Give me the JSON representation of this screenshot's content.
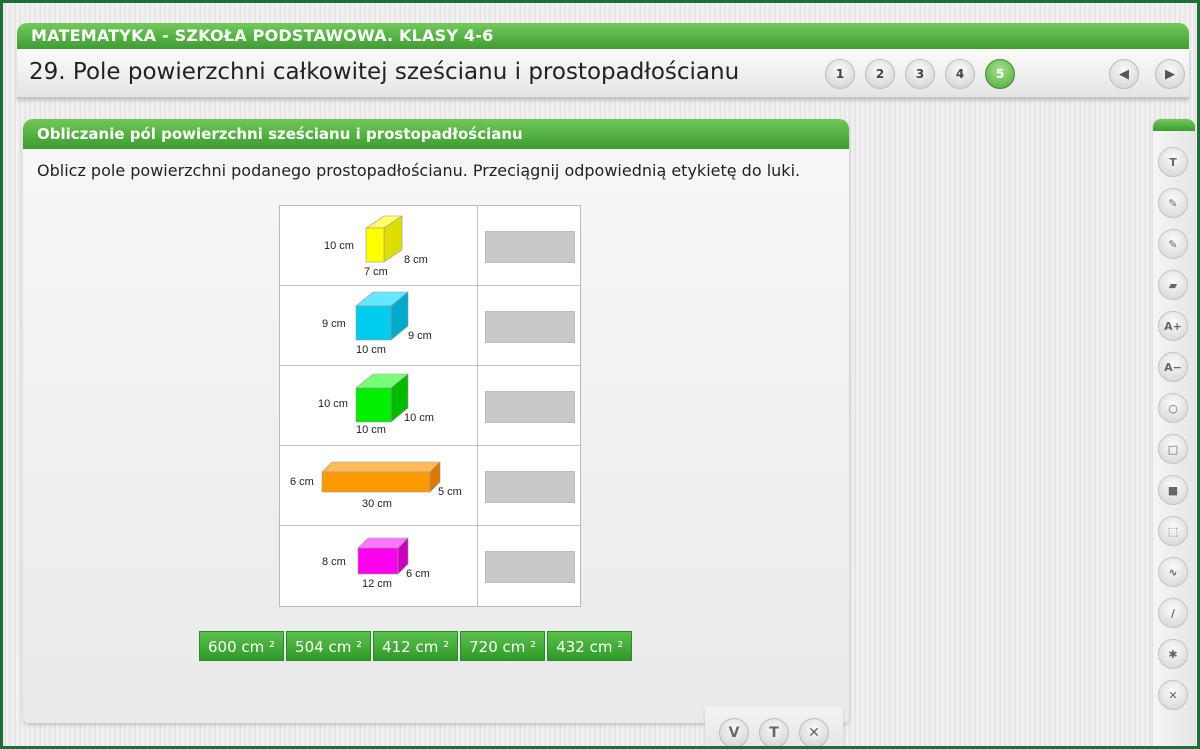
{
  "header": {
    "course": "MATEMATYKA - SZKOŁA PODSTAWOWA. KLASY 4-6",
    "lesson_title": "29. Pole powierzchni całkowitej sześcianu i prostopadłościanu",
    "pages": [
      "1",
      "2",
      "3",
      "4",
      "5"
    ],
    "active_page": "5",
    "prev_glyph": "◀",
    "next_glyph": "▶"
  },
  "panel": {
    "title": "Obliczanie pól powierzchni sześcianu i prostopadłościanu",
    "instruction": "Oblicz pole powierzchni podanego prostopadłościanu. Przeciągnij odpowiednią etykietę do luki."
  },
  "solids": [
    {
      "color": "#ffff00",
      "height_label": "10 cm",
      "depth_label": "8 cm",
      "width_label": "7 cm"
    },
    {
      "color": "#00ccee",
      "height_label": "9 cm",
      "depth_label": "9 cm",
      "width_label": "10 cm"
    },
    {
      "color": "#00ee00",
      "height_label": "10 cm",
      "depth_label": "10 cm",
      "width_label": "10 cm"
    },
    {
      "color": "#ff9900",
      "height_label": "6 cm",
      "depth_label": "5 cm",
      "width_label": "30 cm"
    },
    {
      "color": "#ff00ee",
      "height_label": "8 cm",
      "depth_label": "6 cm",
      "width_label": "12 cm"
    }
  ],
  "answers": [
    "600 cm ²",
    "504 cm ²",
    "412 cm ²",
    "720 cm ²",
    "432 cm ²"
  ],
  "panel_tools": [
    {
      "name": "check",
      "glyph": "V"
    },
    {
      "name": "hint",
      "glyph": "T"
    },
    {
      "name": "reset",
      "glyph": "✕"
    }
  ],
  "sidebar_tools": [
    {
      "name": "text",
      "glyph": "T"
    },
    {
      "name": "pen",
      "glyph": "✎"
    },
    {
      "name": "marker",
      "glyph": "✎"
    },
    {
      "name": "eraser",
      "glyph": "▰"
    },
    {
      "name": "font-larger",
      "glyph": "A+"
    },
    {
      "name": "font-smaller",
      "glyph": "A−"
    },
    {
      "name": "circle",
      "glyph": "○"
    },
    {
      "name": "square-outline",
      "glyph": "□"
    },
    {
      "name": "square-filled",
      "glyph": "■"
    },
    {
      "name": "selection",
      "glyph": "⬚"
    },
    {
      "name": "freehand-line",
      "glyph": "∿"
    },
    {
      "name": "line",
      "glyph": "/"
    },
    {
      "name": "asterisk",
      "glyph": "✱"
    },
    {
      "name": "close",
      "glyph": "✕"
    }
  ]
}
